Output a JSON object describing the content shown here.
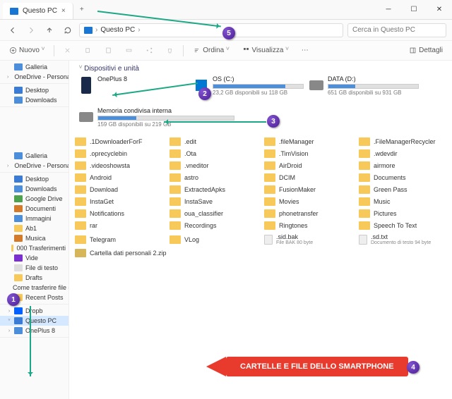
{
  "tab": {
    "title": "Questo PC",
    "close": "×",
    "plus": "+"
  },
  "winctrl": {
    "min": "─",
    "max": "☐",
    "close": "✕"
  },
  "nav": {
    "segment": "Questo PC",
    "search_placeholder": "Cerca in Questo PC"
  },
  "toolbar": {
    "new": "Nuovo",
    "sort": "Ordina",
    "view": "Visualizza",
    "details": "Dettagli"
  },
  "section": {
    "devices": "Dispositivi e unità"
  },
  "devices": [
    {
      "name": "OnePlus 8",
      "icon": "phone"
    },
    {
      "name": "OS (C:)",
      "icon": "win",
      "fill": 80,
      "free": "23,2 GB disponibili su 118 GB"
    },
    {
      "name": "DATA (D:)",
      "icon": "drive",
      "fill": 30,
      "free": "651 GB disponibili su 931 GB"
    },
    {
      "name": "Memoria condivisa interna",
      "icon": "drive",
      "fill": 28,
      "free": "159 GB disponibili su 219 GB"
    }
  ],
  "sidebar": {
    "g1": [
      {
        "label": "Galleria",
        "cls": "f-blue",
        "chev": ""
      },
      {
        "label": "OneDrive - Personal",
        "cls": "f-blue",
        "chev": "›"
      }
    ],
    "g2": [
      {
        "label": "Desktop",
        "cls": "f-monitor",
        "chev": ""
      },
      {
        "label": "Downloads",
        "cls": "f-blue",
        "chev": ""
      }
    ],
    "g3": [
      {
        "label": "Galleria",
        "cls": "f-blue"
      },
      {
        "label": "OneDrive - Personal",
        "cls": "f-blue",
        "chev": "›"
      }
    ],
    "g4": [
      {
        "label": "Desktop",
        "cls": "f-monitor"
      },
      {
        "label": "Downloads",
        "cls": "f-blue"
      },
      {
        "label": "Google Drive",
        "cls": "f-green"
      },
      {
        "label": "Documenti",
        "cls": "f-doc"
      },
      {
        "label": "Immagini",
        "cls": "f-blue"
      },
      {
        "label": "Ab1",
        "cls": "f-yellow"
      },
      {
        "label": "Musica",
        "cls": "f-doc"
      },
      {
        "label": "000 Trasferimenti",
        "cls": "f-yellow"
      },
      {
        "label": "Vide",
        "cls": "f-purple"
      },
      {
        "label": "File di testo",
        "cls": "f-paper"
      },
      {
        "label": "Drafts",
        "cls": "f-yellow"
      },
      {
        "label": "Come trasferire file d",
        "cls": "f-paper"
      },
      {
        "label": "Recent Posts",
        "cls": "f-yellow"
      }
    ],
    "g5": [
      {
        "label": "Dropb",
        "cls": "f-dropb",
        "chev": "›"
      },
      {
        "label": "Questo PC",
        "cls": "f-monitor",
        "chev": "ⱽ",
        "selected": true
      },
      {
        "label": "OnePlus 8",
        "cls": "f-blue",
        "chev": "›"
      }
    ]
  },
  "folders": [
    ".1DownloaderForF",
    ".edit",
    ".fileManager",
    ".FileManagerRecycler",
    ".oprecyclebin",
    ".Ota",
    ".TimVision",
    ".wdevdir",
    ".videoshowsta",
    ".vneditor",
    "AirDroid",
    "airmore",
    "Android",
    "astro",
    "DCIM",
    "Documents",
    "Download",
    "ExtractedApks",
    "FusionMaker",
    "Green Pass",
    "InstaGet",
    "InstaSave",
    "Movies",
    "Music",
    "Notifications",
    "oua_classifier",
    "phonetransfer",
    "Pictures",
    "rar",
    "Recordings",
    "Ringtones",
    "Speech To Text",
    "Telegram",
    "VLog"
  ],
  "files": [
    {
      "name": ".sid.bak",
      "meta": "File BAK\n80 byte"
    },
    {
      "name": ".sd.txt",
      "meta": "Documento di testo\n94 byte"
    }
  ],
  "zip": "Cartella dati personali 2.zip",
  "callout": "CARTELLE E FILE DELLO SMARTPHONE",
  "bubbles": {
    "b1": "1",
    "b2": "2",
    "b3": "3",
    "b4": "4",
    "b5": "5"
  }
}
